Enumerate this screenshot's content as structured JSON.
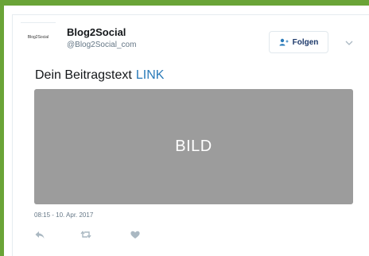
{
  "author": {
    "name": "Blog2Social",
    "handle": "@Blog2Social_com",
    "logo_text": "Blog2Social"
  },
  "follow_button": {
    "label": "Folgen",
    "icon": "add-user-icon"
  },
  "menu": {
    "icon": "chevron-down-icon"
  },
  "tweet": {
    "text": "Dein Beitragstext",
    "link_text": "LINK",
    "image_label": "BILD",
    "timestamp": "08:15 - 10. Apr. 2017"
  },
  "actions": [
    {
      "name": "reply",
      "icon": "reply-icon"
    },
    {
      "name": "retweet",
      "icon": "retweet-icon"
    },
    {
      "name": "like",
      "icon": "heart-icon"
    }
  ],
  "colors": {
    "frame": "#6aa437",
    "link": "#2b7bb9",
    "image_placeholder": "#9c9c9c",
    "follow_label": "#1d3a6b",
    "muted": "#657786"
  }
}
